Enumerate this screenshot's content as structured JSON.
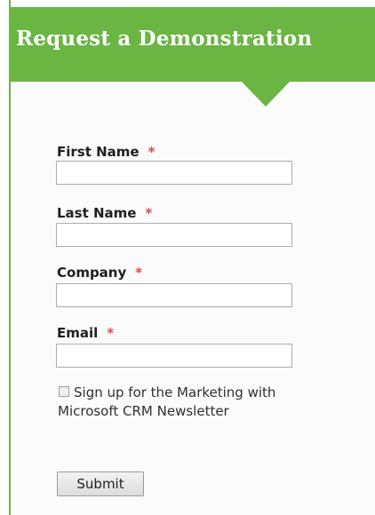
{
  "form": {
    "title": "Request a Demonstration",
    "required_marker": "*",
    "fields": [
      {
        "label": "First Name",
        "value": "",
        "required": true
      },
      {
        "label": "Last Name",
        "value": "",
        "required": true
      },
      {
        "label": "Company",
        "value": "",
        "required": true
      },
      {
        "label": "Email",
        "value": "",
        "required": true
      }
    ],
    "newsletter": {
      "label": "Sign up for the Marketing with Microsoft CRM Newsletter",
      "checked": false
    },
    "submit_label": "Submit"
  },
  "colors": {
    "header_green": "#6bb543",
    "required_red": "#e0454f"
  }
}
